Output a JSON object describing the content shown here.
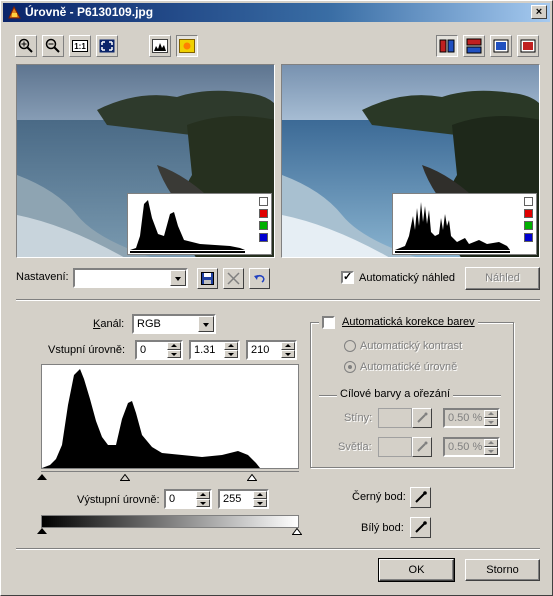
{
  "window": {
    "title": "Úrovně - P6130109.jpg",
    "close_label": "×"
  },
  "toolbar": {
    "zoom_in": "zoom-in-icon",
    "zoom_out": "zoom-out-icon",
    "actual_size": "1:1",
    "fit": "fit-window-icon"
  },
  "settings": {
    "label": "Nastavení:",
    "value": ""
  },
  "auto_preview": {
    "label": "Automatický náhled",
    "checked": true
  },
  "preview_button": "Náhled",
  "channel": {
    "label": "Kanál:",
    "value": "RGB"
  },
  "input_levels": {
    "label": "Vstupní úrovně:",
    "black": "0",
    "gamma": "1.31",
    "white": "210"
  },
  "output_levels": {
    "label": "Výstupní úrovně:",
    "black": "0",
    "white": "255"
  },
  "auto_correct": {
    "label": "Automatická korekce barev",
    "checked": false,
    "options": [
      "Automatický kontrast",
      "Automatické úrovně"
    ],
    "selected": 1
  },
  "target": {
    "title": "Cílové barvy a ořezání",
    "shadows_label": "Stíny:",
    "shadows_value": "0.50 %",
    "highlights_label": "Světla:",
    "highlights_value": "0.50 %"
  },
  "black_point": "Černý bod:",
  "white_point": "Bílý bod:",
  "ok": "OK",
  "cancel": "Storno",
  "colors": {
    "title_start": "#0a246a",
    "face": "#d4d0c8"
  }
}
